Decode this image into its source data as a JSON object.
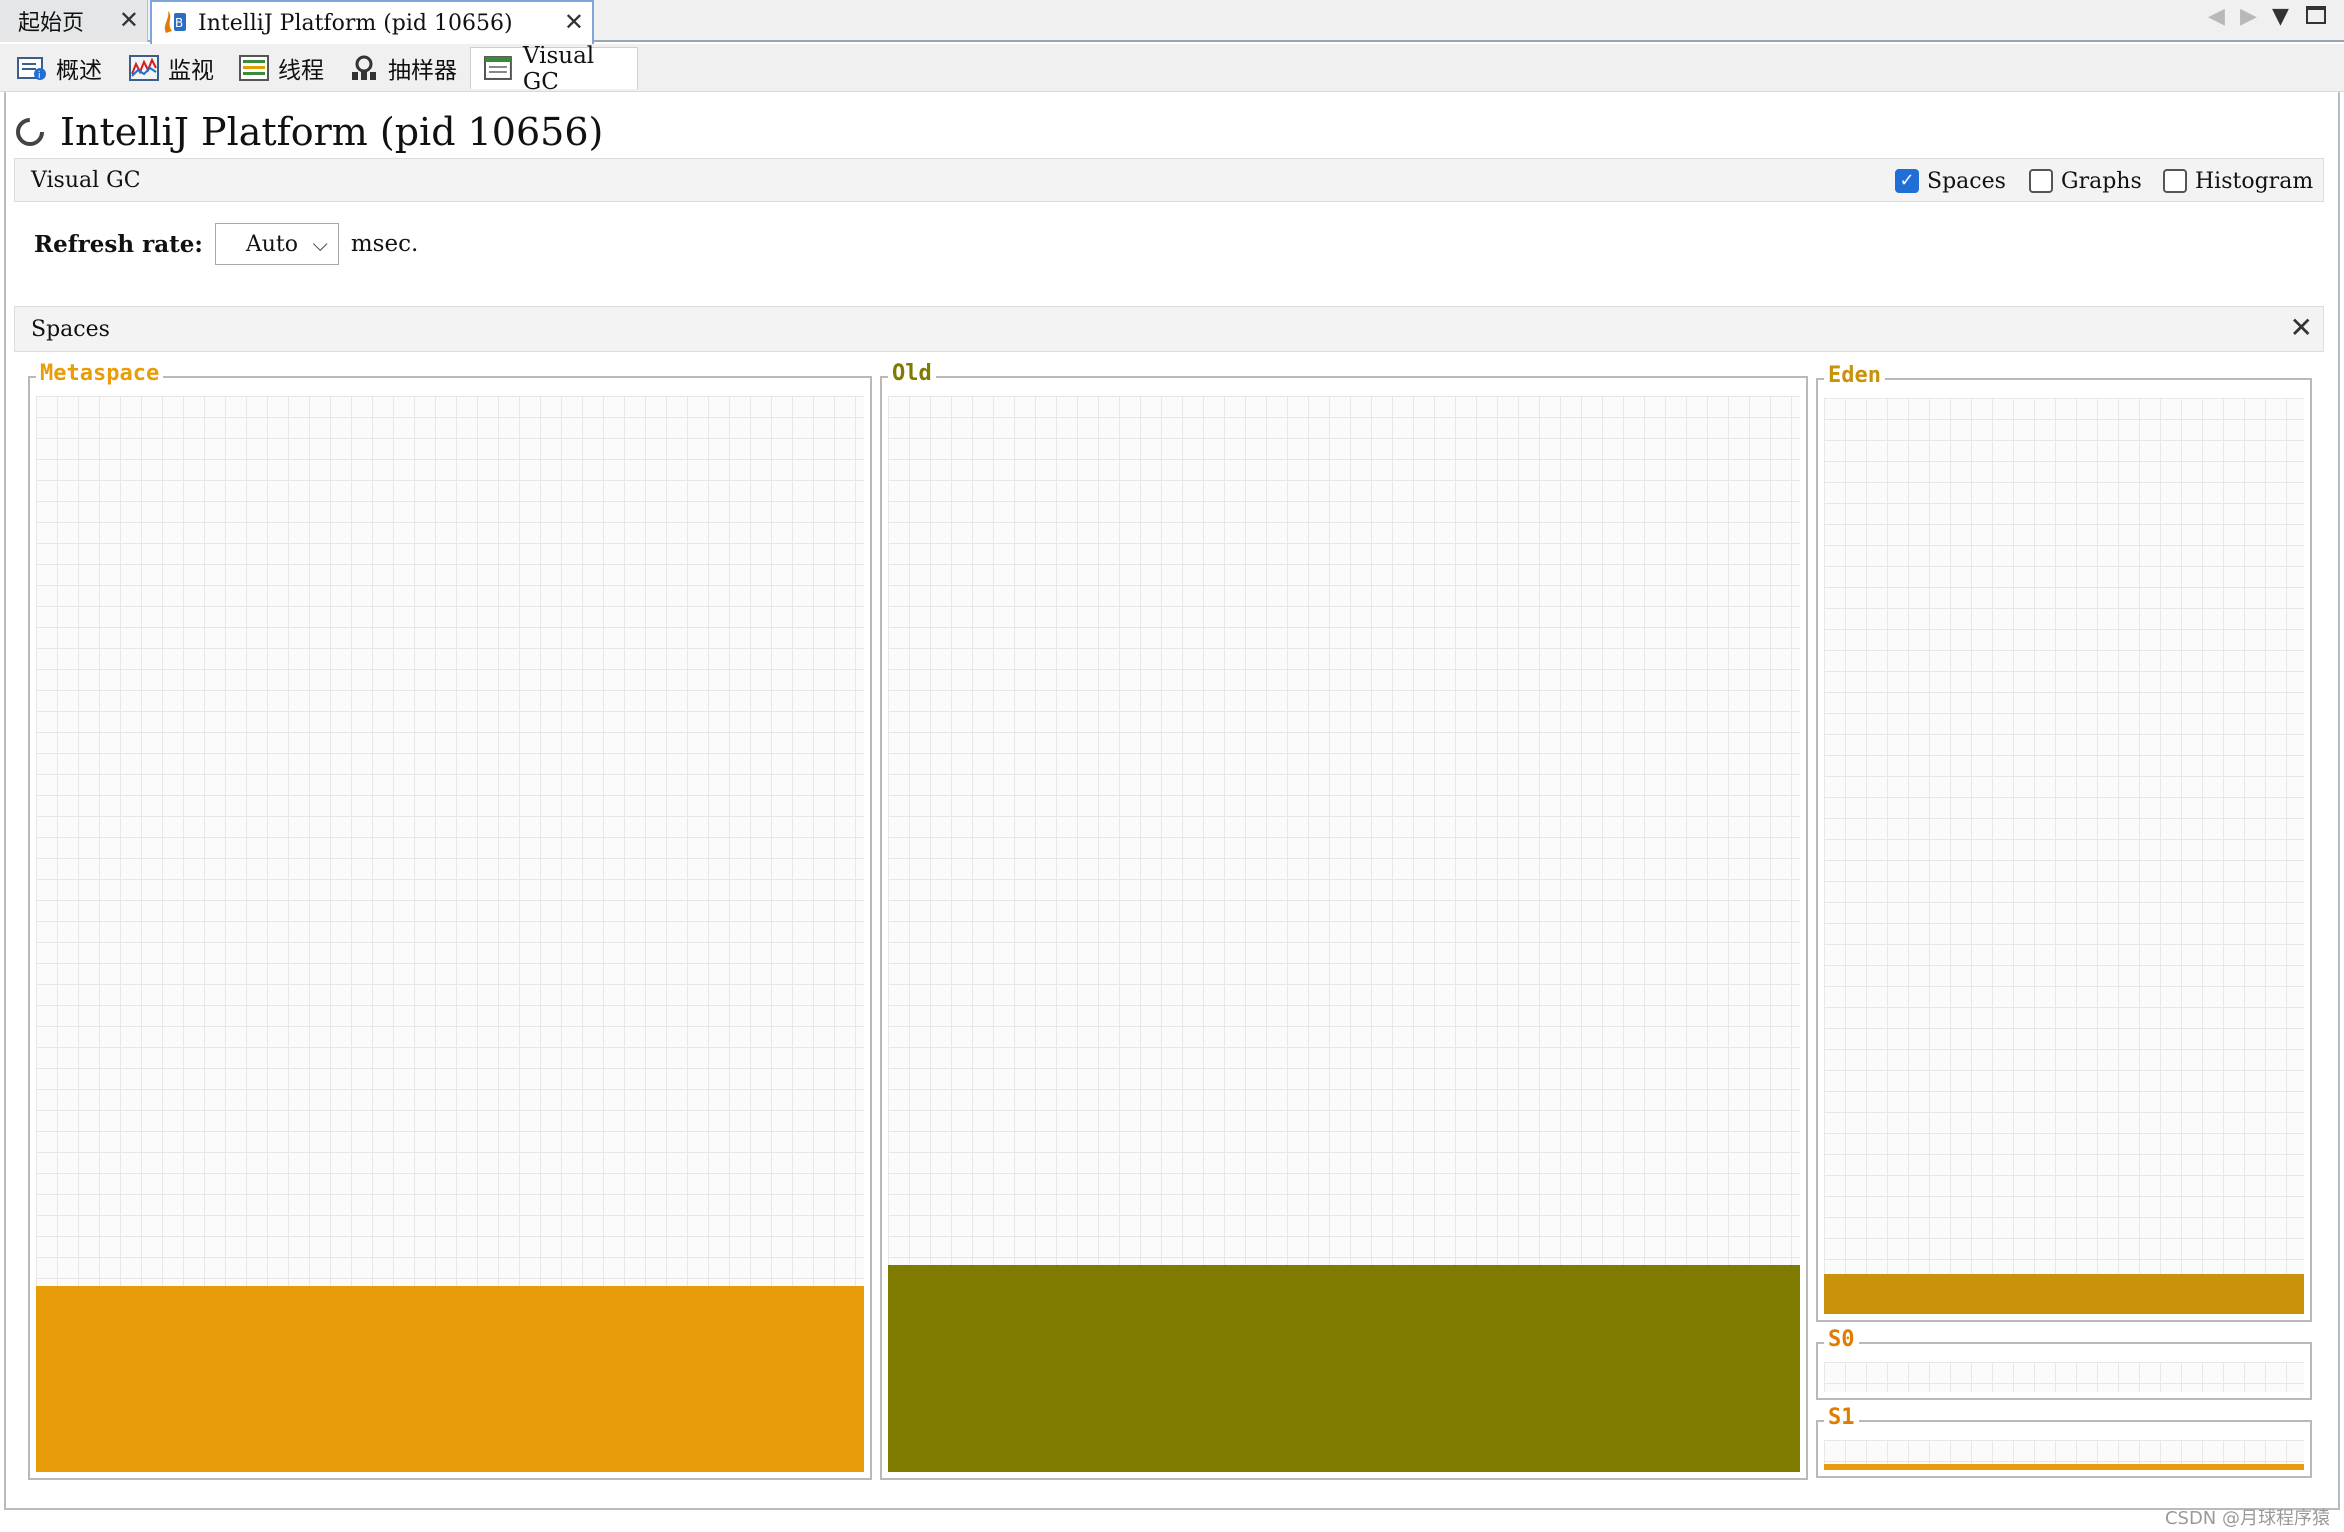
{
  "doc_tabs": [
    {
      "label": "起始页",
      "active": false
    },
    {
      "label": "IntelliJ Platform (pid 10656)",
      "active": true
    }
  ],
  "sub_tabs": [
    {
      "label": "概述",
      "icon": "overview-icon"
    },
    {
      "label": "监视",
      "icon": "monitor-icon"
    },
    {
      "label": "线程",
      "icon": "threads-icon"
    },
    {
      "label": "抽样器",
      "icon": "sampler-icon"
    },
    {
      "label": "Visual GC",
      "icon": "visual-gc-icon",
      "active": true
    }
  ],
  "page": {
    "title_app": "IntelliJ Platform",
    "title_pid": "(pid 10656)"
  },
  "visual_gc": {
    "label": "Visual GC",
    "options": [
      {
        "label": "Spaces",
        "checked": true
      },
      {
        "label": "Graphs",
        "checked": false
      },
      {
        "label": "Histogram",
        "checked": false
      }
    ]
  },
  "refresh": {
    "label": "Refresh rate:",
    "value": "Auto",
    "unit": "msec."
  },
  "spaces": {
    "label": "Spaces",
    "panels": {
      "metaspace": {
        "title": "Metaspace",
        "fill_fraction": 0.17,
        "color": "#e99c0a",
        "title_color": "#e99c0a"
      },
      "old": {
        "title": "Old",
        "fill_fraction": 0.19,
        "color": "#7f7b00",
        "title_color": "#7f7b00"
      },
      "eden": {
        "title": "Eden",
        "fill_fraction": 0.04,
        "color": "#c8920a",
        "title_color": "#c8920a"
      },
      "s0": {
        "title": "S0",
        "fill_fraction": 0.0,
        "color": "#e99c0a",
        "title_color": "#e07c00"
      },
      "s1": {
        "title": "S1",
        "fill_fraction": 0.04,
        "color": "#e99c0a",
        "title_color": "#e07c00"
      }
    }
  },
  "watermark": "CSDN @月球程序猿"
}
